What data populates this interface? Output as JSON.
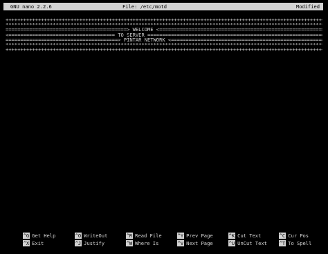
{
  "titlebar": {
    "app": "GNU nano 2.2.6",
    "file": "File: /etc/motd",
    "status": "Modified"
  },
  "lines": [
    "++++++++++++++++++++++++++++++++++++++++++++++++++++++++++++++++++++++++++++++++++++++++++++++++++++++++++++++++++++++++++",
    "***************************************************************************************************************************",
    "=========================================> WELCOME <===========================================================",
    "<==================================== TO SERVER ===============================================================",
    "======================================> PINTAR NETWORK <========================================================",
    "***************************************************************************************************************************",
    "++++++++++++++++++++++++++++++++++++++++++++++++++++++++++++++++++++++++++++++++++++++++++++++++++++++++++++++++++++++++++"
  ],
  "shortcuts": {
    "row1": [
      {
        "key": "^G",
        "label": "Get Help"
      },
      {
        "key": "^O",
        "label": "WriteOut"
      },
      {
        "key": "^R",
        "label": "Read File"
      },
      {
        "key": "^Y",
        "label": "Prev Page"
      },
      {
        "key": "^K",
        "label": "Cut Text"
      },
      {
        "key": "^C",
        "label": "Cur Pos"
      }
    ],
    "row2": [
      {
        "key": "^X",
        "label": "Exit"
      },
      {
        "key": "^J",
        "label": "Justify"
      },
      {
        "key": "^W",
        "label": "Where Is"
      },
      {
        "key": "^V",
        "label": "Next Page"
      },
      {
        "key": "^U",
        "label": "UnCut Text"
      },
      {
        "key": "^T",
        "label": "To Spell"
      }
    ]
  }
}
